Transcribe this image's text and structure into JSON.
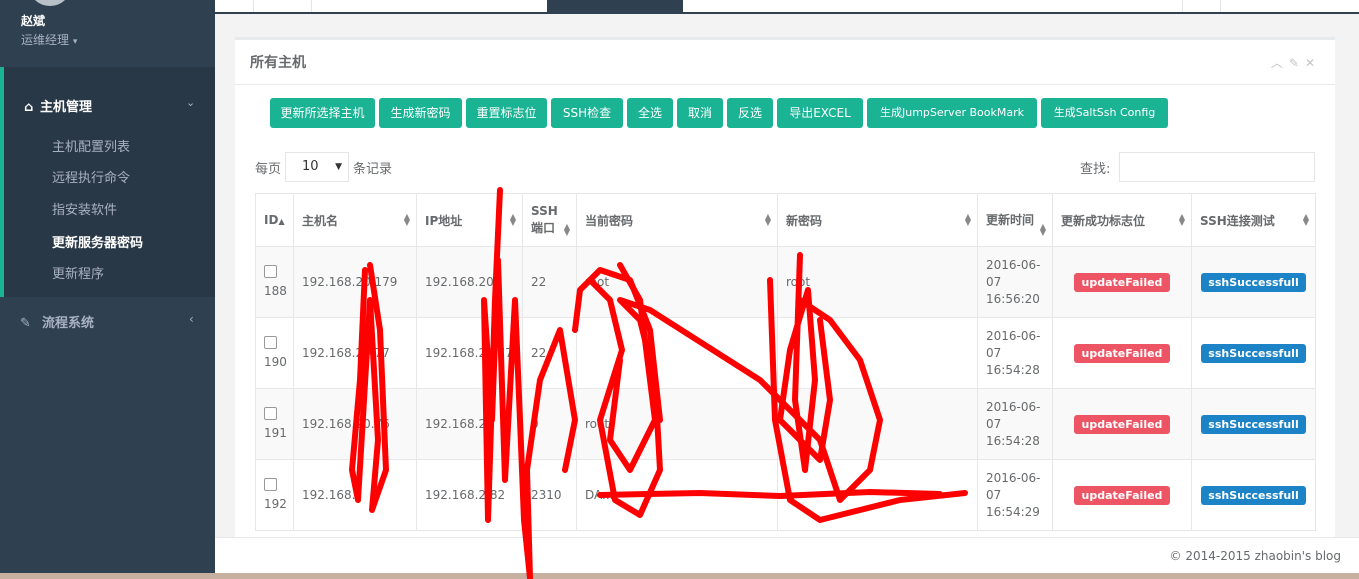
{
  "user": {
    "name": "赵斌",
    "role": "运维经理"
  },
  "nav": {
    "section1": "主机管理",
    "items": [
      "主机配置列表",
      "远程执行命令",
      "指安装软件",
      "更新服务器密码",
      "更新程序"
    ],
    "active_index": 3,
    "section2": "流程系统"
  },
  "panel": {
    "title": "所有主机"
  },
  "buttons": [
    "更新所选择主机",
    "生成新密码",
    "重置标志位",
    "SSH检查",
    "全选",
    "取消",
    "反选",
    "导出EXCEL",
    "生成JumpServer BookMark",
    "生成SaltSsh Config"
  ],
  "paging": {
    "per_page_label": "每页",
    "per_page_value": "10",
    "records_label": "条记录",
    "search_label": "查找:"
  },
  "table": {
    "headers": [
      "ID",
      "主机名",
      "IP地址",
      "SSH端口",
      "当前密码",
      "新密码",
      "更新时间",
      "更新成功标志位",
      "SSH连接测试"
    ],
    "rows": [
      {
        "id": "188",
        "host": "192.168.20.179",
        "ip": "192.168.20.",
        "port": "22",
        "cur": "root",
        "new": "root",
        "time": "2016-06-07 16:56:20",
        "flag": "updateFailed",
        "ssh": "sshSuccessfull"
      },
      {
        "id": "190",
        "host": "192.168.20.77",
        "ip": "192.168.20.77",
        "port": "22",
        "cur": "",
        "new": "",
        "time": "2016-06-07 16:54:28",
        "flag": "updateFailed",
        "ssh": "sshSuccessfull"
      },
      {
        "id": "191",
        "host": "192.168.20.76",
        "ip": "192.168.2",
        "port": "0",
        "cur": "root",
        "new": "",
        "time": "2016-06-07 16:54:28",
        "flag": "updateFailed",
        "ssh": "sshSuccessfull"
      },
      {
        "id": "192",
        "host": "192.168.",
        "ip": "192.168.2.82",
        "port": "2310",
        "cur": "DA....",
        "new": "A",
        "time": "2016-06-07 16:54:29",
        "flag": "updateFailed",
        "ssh": "sshSuccessfull"
      }
    ]
  },
  "footer": {
    "copyright": "© 2014-2015 zhaobin's blog"
  },
  "colors": {
    "sidebar": "#2f4050",
    "accent": "#1ab394",
    "danger": "#ed5565",
    "info": "#1c84c6",
    "scribble": "#ff0000"
  }
}
